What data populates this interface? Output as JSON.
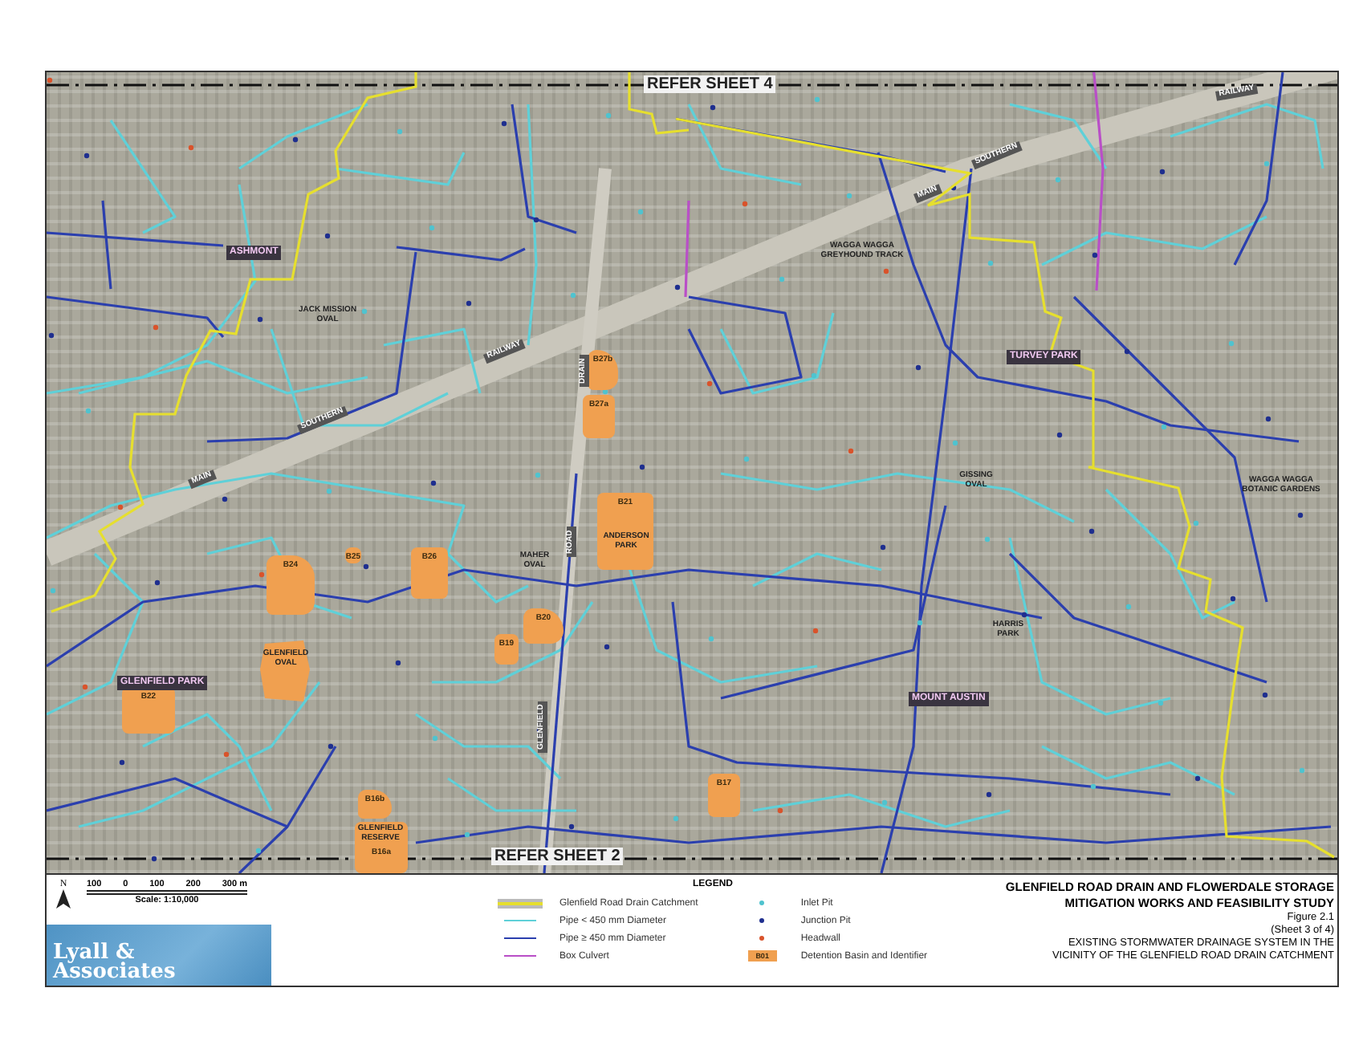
{
  "map": {
    "labels": [
      {
        "kind": "sheet",
        "text": "REFER SHEET 4"
      },
      {
        "kind": "sheet",
        "text": "REFER SHEET 2"
      },
      {
        "kind": "suburb",
        "text": "ASHMONT"
      },
      {
        "kind": "park",
        "text": "JACK MISSION OVAL"
      },
      {
        "kind": "road",
        "text": "RAILWAY"
      },
      {
        "kind": "road",
        "text": "DRAIN"
      },
      {
        "kind": "road",
        "text": "MAIN"
      },
      {
        "kind": "road",
        "text": "SOUTHERN"
      },
      {
        "kind": "road",
        "text": "RAILWAY"
      },
      {
        "kind": "road",
        "text": "MAIN"
      },
      {
        "kind": "road",
        "text": "SOUTHERN"
      },
      {
        "kind": "park",
        "text": "WAGGA WAGGA GREYHOUND TRACK"
      },
      {
        "kind": "suburb",
        "text": "TURVEY PARK"
      },
      {
        "kind": "park",
        "text": "GISSING OVAL"
      },
      {
        "kind": "park",
        "text": "WAGGA WAGGA BOTANIC GARDENS"
      },
      {
        "kind": "park",
        "text": "MAHER OVAL"
      },
      {
        "kind": "park",
        "text": "ANDERSON PARK"
      },
      {
        "kind": "park",
        "text": "HARRIS PARK"
      },
      {
        "kind": "suburb",
        "text": "MOUNT AUSTIN"
      },
      {
        "kind": "park",
        "text": "GLENFIELD OVAL"
      },
      {
        "kind": "suburb",
        "text": "GLENFIELD PARK"
      },
      {
        "kind": "park",
        "text": "GLENFIELD RESERVE"
      },
      {
        "kind": "road",
        "text": "GLENFIELD"
      },
      {
        "kind": "road",
        "text": "ROAD"
      }
    ],
    "basins": [
      {
        "id": "B27b"
      },
      {
        "id": "B27a"
      },
      {
        "id": "B21"
      },
      {
        "id": "B24"
      },
      {
        "id": "B25"
      },
      {
        "id": "B26"
      },
      {
        "id": "B20"
      },
      {
        "id": "B19"
      },
      {
        "id": "B22"
      },
      {
        "id": "B16b"
      },
      {
        "id": "B16a"
      },
      {
        "id": "B17"
      }
    ]
  },
  "scale": {
    "north": "N",
    "ticks": [
      "100",
      "0",
      "100",
      "200",
      "300 m"
    ],
    "caption": "Scale: 1:10,000"
  },
  "logo": {
    "lines": [
      "Lyall &",
      "Associates"
    ]
  },
  "legend": {
    "title": "LEGEND",
    "items": [
      {
        "kind": "band",
        "color": "#e6df2e",
        "label": "Glenfield Road Drain Catchment"
      },
      {
        "kind": "line",
        "color": "#5fd0d8",
        "label": "Pipe < 450 mm Diameter"
      },
      {
        "kind": "line",
        "color": "#2b3fae",
        "label": "Pipe ≥ 450 mm Diameter"
      },
      {
        "kind": "line",
        "color": "#b94fc7",
        "label": "Box Culvert"
      },
      {
        "kind": "dot",
        "color": "#4fc3cf",
        "label": "Inlet Pit"
      },
      {
        "kind": "dot",
        "color": "#1f2f8f",
        "label": "Junction Pit"
      },
      {
        "kind": "dot",
        "color": "#d9532b",
        "label": "Headwall"
      },
      {
        "kind": "swatch",
        "color": "#f0a050",
        "swatch_text": "B01",
        "label": "Detention Basin and Identifier"
      }
    ]
  },
  "title_block": {
    "title_lines": [
      "GLENFIELD ROAD DRAIN AND FLOWERDALE STORAGE",
      "MITIGATION WORKS AND FEASIBILITY STUDY"
    ],
    "figure": "Figure 2.1",
    "sheet": "(Sheet 3 of 4)",
    "caption_lines": [
      "EXISTING STORMWATER DRAINAGE SYSTEM IN THE",
      "VICINITY OF THE GLENFIELD ROAD DRAIN CATCHMENT"
    ]
  }
}
